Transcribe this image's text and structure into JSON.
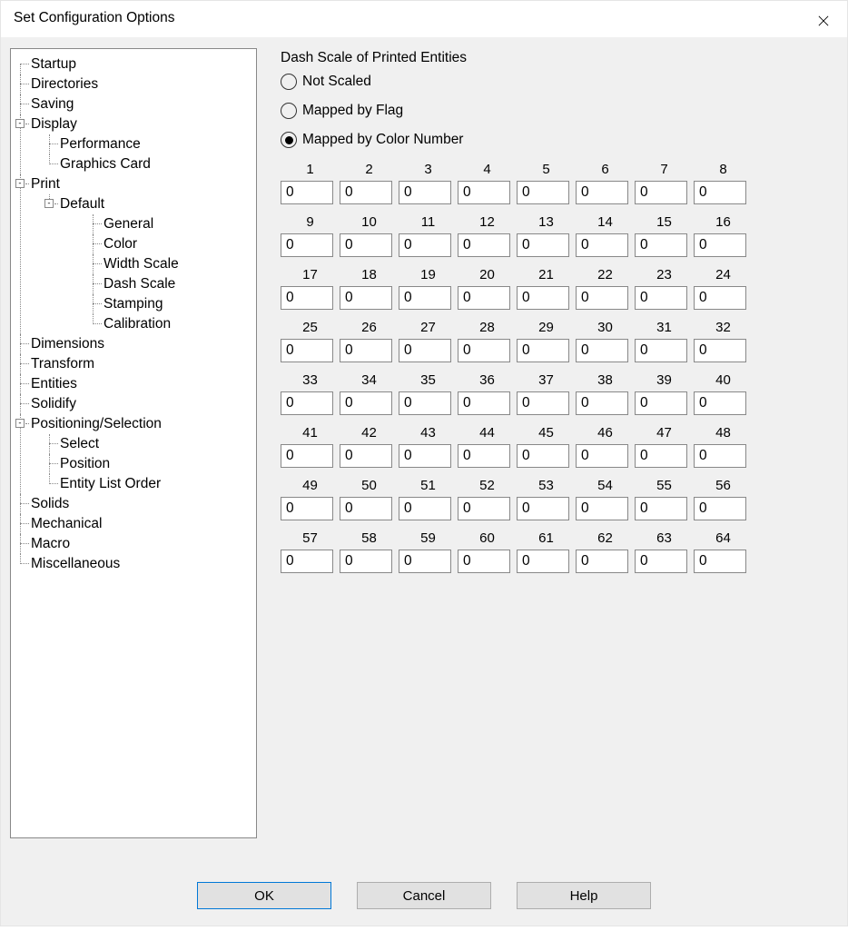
{
  "dialog": {
    "title": "Set Configuration Options"
  },
  "tree": {
    "startup": "Startup",
    "directories": "Directories",
    "saving": "Saving",
    "display": "Display",
    "performance": "Performance",
    "graphics_card": "Graphics Card",
    "print": "Print",
    "default": "Default",
    "general": "General",
    "color": "Color",
    "width_scale": "Width Scale",
    "dash_scale": "Dash Scale",
    "stamping": "Stamping",
    "calibration": "Calibration",
    "dimensions": "Dimensions",
    "transform": "Transform",
    "entities": "Entities",
    "solidify": "Solidify",
    "pos_sel": "Positioning/Selection",
    "select": "Select",
    "position": "Position",
    "entity_list_order": "Entity List Order",
    "solids": "Solids",
    "mechanical": "Mechanical",
    "macro": "Macro",
    "miscellaneous": "Miscellaneous",
    "minus": "-"
  },
  "settings": {
    "section_title": "Dash Scale of Printed Entities",
    "radio_not_scaled": "Not Scaled",
    "radio_mapped_flag": "Mapped by Flag",
    "radio_mapped_color": "Mapped by Color Number",
    "selected": "color",
    "headers": [
      "1",
      "2",
      "3",
      "4",
      "5",
      "6",
      "7",
      "8",
      "9",
      "10",
      "11",
      "12",
      "13",
      "14",
      "15",
      "16",
      "17",
      "18",
      "19",
      "20",
      "21",
      "22",
      "23",
      "24",
      "25",
      "26",
      "27",
      "28",
      "29",
      "30",
      "31",
      "32",
      "33",
      "34",
      "35",
      "36",
      "37",
      "38",
      "39",
      "40",
      "41",
      "42",
      "43",
      "44",
      "45",
      "46",
      "47",
      "48",
      "49",
      "50",
      "51",
      "52",
      "53",
      "54",
      "55",
      "56",
      "57",
      "58",
      "59",
      "60",
      "61",
      "62",
      "63",
      "64"
    ],
    "values": [
      "0",
      "0",
      "0",
      "0",
      "0",
      "0",
      "0",
      "0",
      "0",
      "0",
      "0",
      "0",
      "0",
      "0",
      "0",
      "0",
      "0",
      "0",
      "0",
      "0",
      "0",
      "0",
      "0",
      "0",
      "0",
      "0",
      "0",
      "0",
      "0",
      "0",
      "0",
      "0",
      "0",
      "0",
      "0",
      "0",
      "0",
      "0",
      "0",
      "0",
      "0",
      "0",
      "0",
      "0",
      "0",
      "0",
      "0",
      "0",
      "0",
      "0",
      "0",
      "0",
      "0",
      "0",
      "0",
      "0",
      "0",
      "0",
      "0",
      "0",
      "0",
      "0",
      "0",
      "0"
    ]
  },
  "buttons": {
    "ok": "OK",
    "cancel": "Cancel",
    "help": "Help"
  }
}
